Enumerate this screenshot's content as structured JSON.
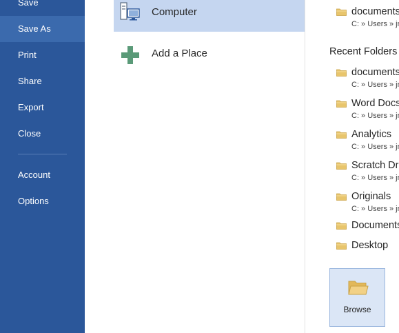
{
  "nav": {
    "items": [
      {
        "label": "Save"
      },
      {
        "label": "Save As"
      },
      {
        "label": "Print"
      },
      {
        "label": "Share"
      },
      {
        "label": "Export"
      },
      {
        "label": "Close"
      },
      {
        "label": "Account"
      },
      {
        "label": "Options"
      }
    ],
    "selected": "Save As",
    "background": "#2b579a"
  },
  "places": {
    "items": [
      {
        "label": "Computer",
        "icon": "computer-icon"
      },
      {
        "label": "Add a Place",
        "icon": "add-place-icon"
      }
    ],
    "selected": "Computer",
    "selected_color": "#c5d6f0"
  },
  "folders": {
    "current": [
      {
        "name": "documents",
        "path": "C: » Users » jr"
      }
    ],
    "recent_heading": "Recent Folders",
    "recent": [
      {
        "name": "documents",
        "path": "C: » Users » jr"
      },
      {
        "name": "Word Docs",
        "path": "C: » Users » jr"
      },
      {
        "name": "Analytics",
        "path": "C: » Users » jr"
      },
      {
        "name": "Scratch Dr",
        "path": "C: » Users » jr"
      },
      {
        "name": "Originals",
        "path": "C: » Users » jr"
      },
      {
        "name": "Documents",
        "path": ""
      },
      {
        "name": "Desktop",
        "path": ""
      }
    ],
    "folder_icon_color": "#e8c56c"
  },
  "browse": {
    "label": "Browse",
    "icon": "folder-open-icon"
  }
}
